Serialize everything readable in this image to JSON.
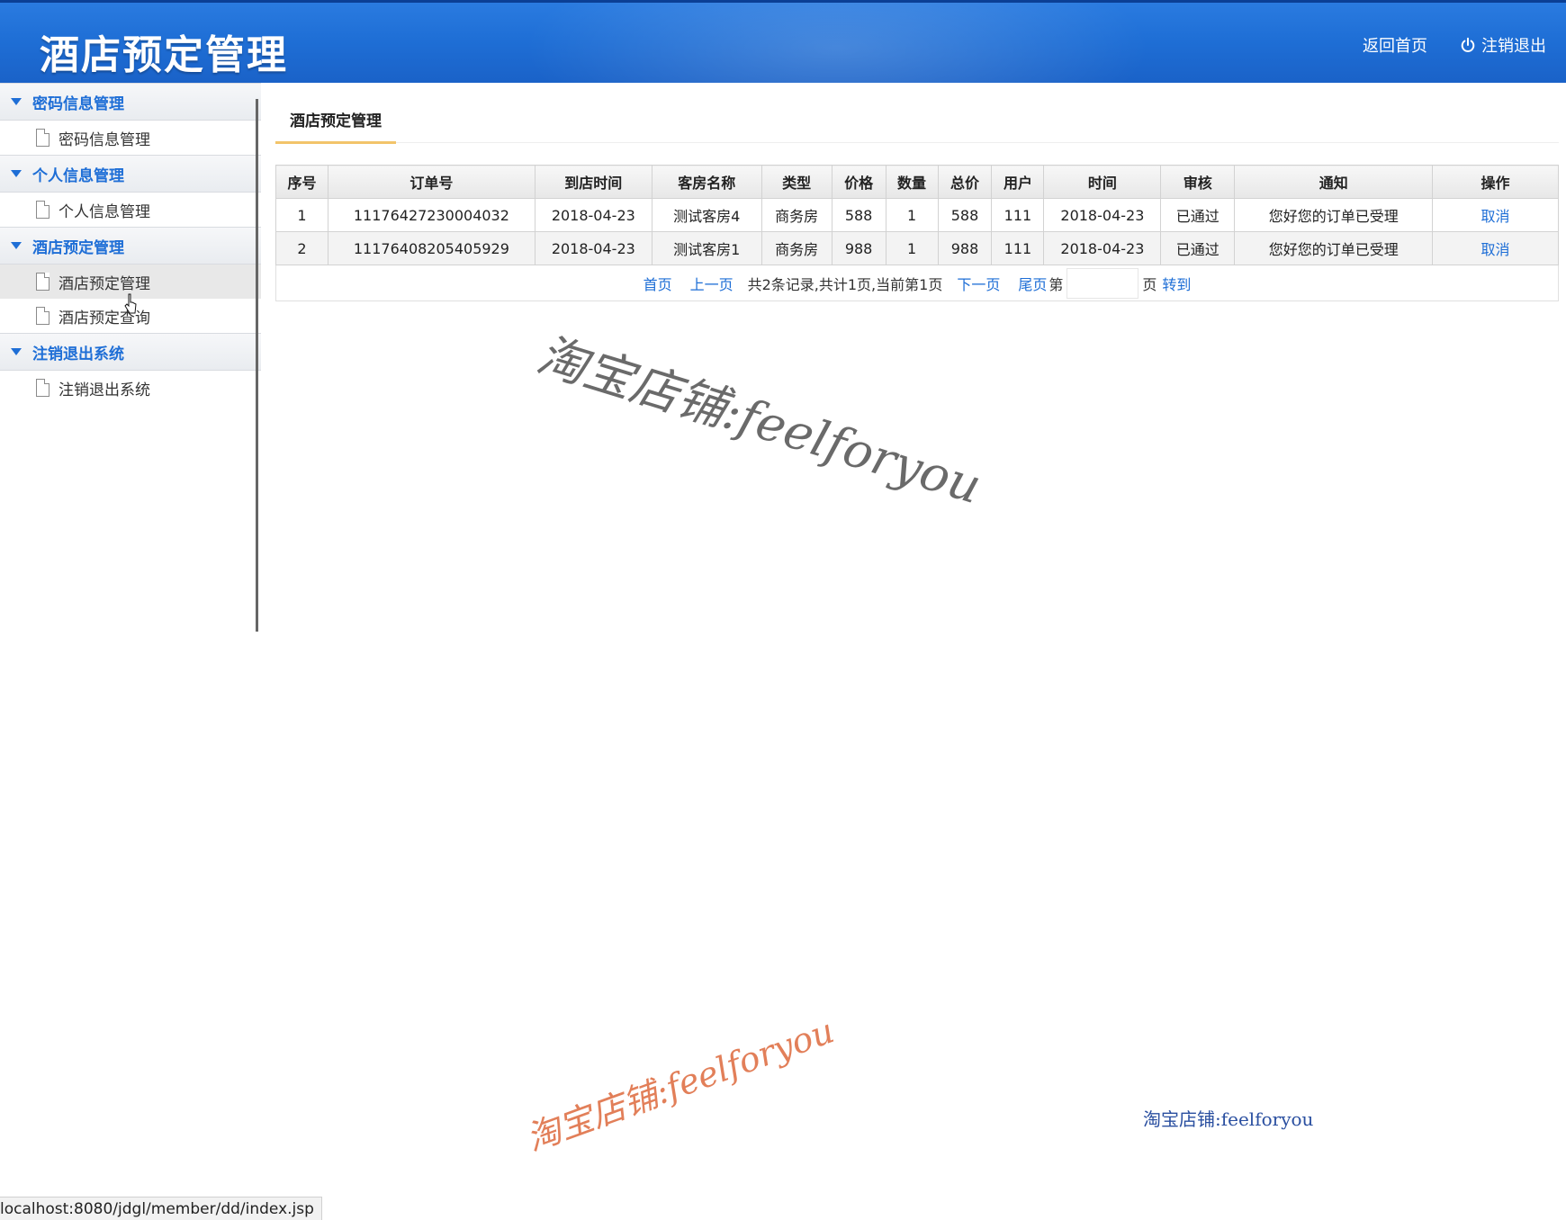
{
  "header": {
    "title": "酒店预定管理",
    "nav_home": "返回首页",
    "nav_logout": "注销退出"
  },
  "sidebar": {
    "groups": [
      {
        "label": "密码信息管理",
        "items": [
          {
            "label": "密码信息管理"
          }
        ]
      },
      {
        "label": "个人信息管理",
        "items": [
          {
            "label": "个人信息管理"
          }
        ]
      },
      {
        "label": "酒店预定管理",
        "items": [
          {
            "label": "酒店预定管理"
          },
          {
            "label": "酒店预定查询"
          }
        ]
      },
      {
        "label": "注销退出系统",
        "items": [
          {
            "label": "注销退出系统"
          }
        ]
      }
    ]
  },
  "main": {
    "panel_title": "酒店预定管理",
    "columns": [
      "序号",
      "订单号",
      "到店时间",
      "客房名称",
      "类型",
      "价格",
      "数量",
      "总价",
      "用户",
      "时间",
      "审核",
      "通知",
      "操作"
    ],
    "rows": [
      {
        "no": "1",
        "order_id": "11176427230004032",
        "arrival": "2018-04-23",
        "room_name": "测试客房4",
        "type": "商务房",
        "price": "588",
        "qty": "1",
        "total": "588",
        "user": "111",
        "time": "2018-04-23",
        "audit": "已通过",
        "notice": "您好您的订单已受理",
        "action": "取消"
      },
      {
        "no": "2",
        "order_id": "11176408205405929",
        "arrival": "2018-04-23",
        "room_name": "测试客房1",
        "type": "商务房",
        "price": "988",
        "qty": "1",
        "total": "988",
        "user": "111",
        "time": "2018-04-23",
        "audit": "已通过",
        "notice": "您好您的订单已受理",
        "action": "取消"
      }
    ],
    "pager": {
      "first": "首页",
      "prev": "上一页",
      "summary": "共2条记录,共计1页,当前第1页",
      "next": "下一页",
      "last": "尾页",
      "page_prefix": "第",
      "page_suffix": "页",
      "go": "转到",
      "page_input_value": ""
    }
  },
  "watermarks": {
    "wm1": "淘宝店铺:feelforyou",
    "wm2": "淘宝店铺:feelforyou",
    "wm3": "淘宝店铺:feelforyou"
  },
  "statusbar": {
    "url": "localhost:8080/jdgl/member/dd/index.jsp"
  },
  "colors": {
    "header_blue": "#1f6fd6",
    "link_blue": "#1e6ed6",
    "tab_underline": "#f2c46a"
  }
}
